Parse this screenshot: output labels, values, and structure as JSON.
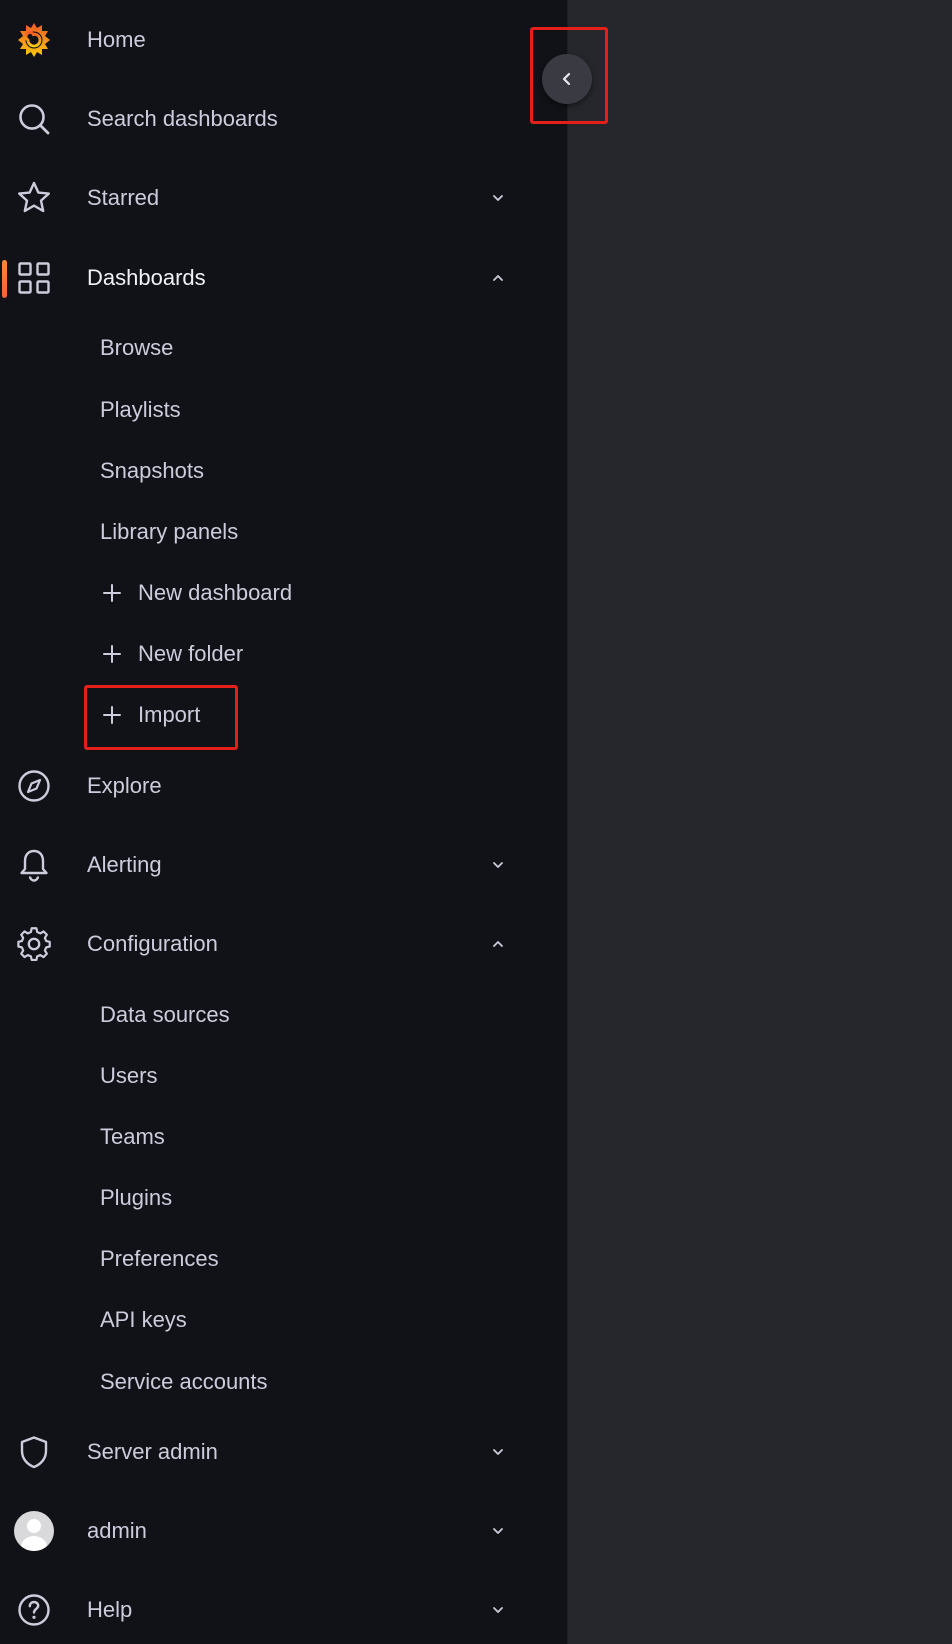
{
  "nav": {
    "home": {
      "label": "Home",
      "icon": "grafana-logo-icon"
    },
    "search": {
      "label": "Search dashboards",
      "icon": "search-icon"
    },
    "starred": {
      "label": "Starred",
      "icon": "star-icon"
    },
    "dashboards": {
      "label": "Dashboards",
      "icon": "apps-grid-icon",
      "children": [
        {
          "label": "Browse"
        },
        {
          "label": "Playlists"
        },
        {
          "label": "Snapshots"
        },
        {
          "label": "Library panels"
        },
        {
          "label": "New dashboard"
        },
        {
          "label": "New folder"
        },
        {
          "label": "Import"
        }
      ]
    },
    "explore": {
      "label": "Explore",
      "icon": "compass-icon"
    },
    "alerting": {
      "label": "Alerting",
      "icon": "bell-icon"
    },
    "configuration": {
      "label": "Configuration",
      "icon": "gear-icon",
      "children": [
        {
          "label": "Data sources"
        },
        {
          "label": "Users"
        },
        {
          "label": "Teams"
        },
        {
          "label": "Plugins"
        },
        {
          "label": "Preferences"
        },
        {
          "label": "API keys"
        },
        {
          "label": "Service accounts"
        }
      ]
    },
    "server_admin": {
      "label": "Server admin",
      "icon": "shield-icon"
    },
    "admin": {
      "label": "admin",
      "icon": "avatar-icon"
    },
    "help": {
      "label": "Help",
      "icon": "question-circle-icon"
    }
  },
  "colors": {
    "sidebar_bg": "#111217",
    "main_bg": "#26272c",
    "text": "#ccccdc",
    "accent": "#ff8833",
    "highlight": "#e5201b"
  }
}
